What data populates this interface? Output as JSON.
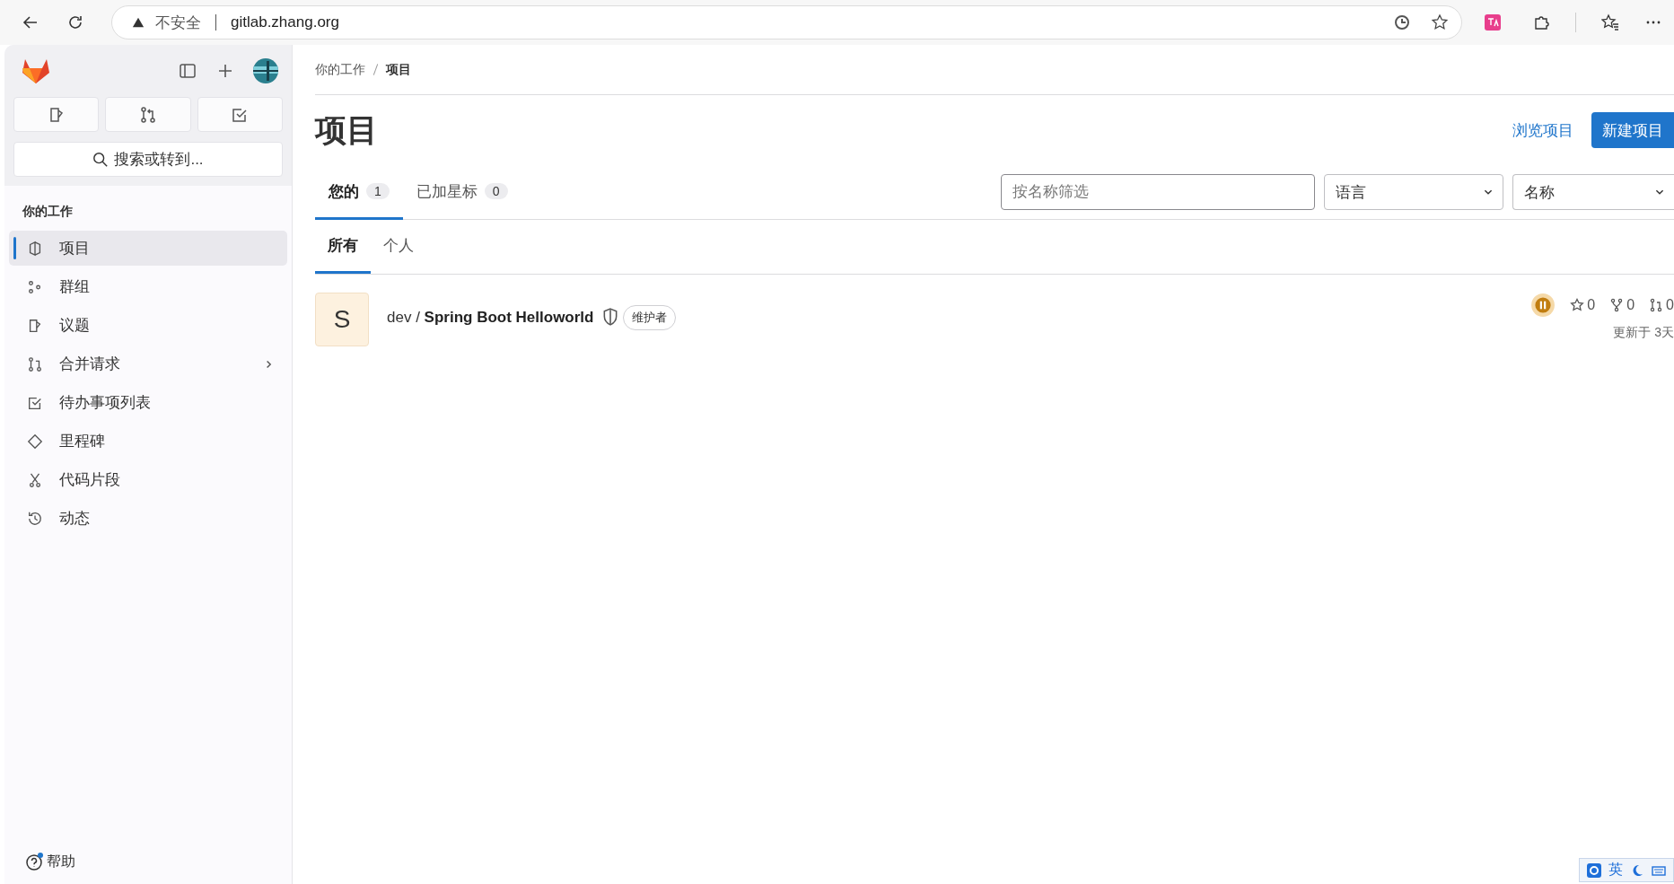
{
  "browser": {
    "security": "不安全",
    "url": "gitlab.zhang.org"
  },
  "sidebar": {
    "search_placeholder": "搜索或转到...",
    "section": "你的工作",
    "items": [
      {
        "label": "项目",
        "selected": true
      },
      {
        "label": "群组",
        "selected": false
      },
      {
        "label": "议题",
        "selected": false
      },
      {
        "label": "合并请求",
        "selected": false
      },
      {
        "label": "待办事项列表",
        "selected": false
      },
      {
        "label": "里程碑",
        "selected": false
      },
      {
        "label": "代码片段",
        "selected": false
      },
      {
        "label": "动态",
        "selected": false
      }
    ],
    "help": "帮助"
  },
  "breadcrumb": [
    "你的工作",
    "项目"
  ],
  "title": "项目",
  "actions": {
    "browse": "浏览项目",
    "new": "新建项目"
  },
  "tabs": [
    {
      "label": "您的",
      "count": "1",
      "selected": true
    },
    {
      "label": "已加星标",
      "count": "0",
      "selected": false
    }
  ],
  "filter": {
    "placeholder": "按名称筛选"
  },
  "selects": [
    "语言",
    "名称"
  ],
  "subtabs": [
    {
      "label": "所有",
      "selected": true
    },
    {
      "label": "个人",
      "selected": false
    }
  ],
  "projects": [
    {
      "avatar": "S",
      "namespace": "dev / ",
      "name": "Spring Boot Helloworld",
      "role": "维护者",
      "stars": "0",
      "forks": "0",
      "merge_requests": "0",
      "updated": "更新于 3天"
    }
  ],
  "ime": {
    "mode": "英"
  }
}
